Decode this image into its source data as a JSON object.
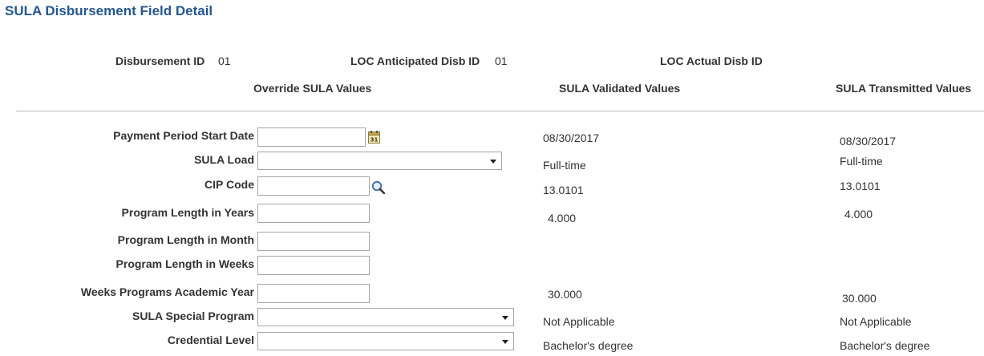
{
  "page": {
    "title": "SULA Disbursement Field Detail"
  },
  "header": {
    "disbursement_id_label": "Disbursement ID",
    "disbursement_id_value": "01",
    "loc_anticipated_label": "LOC Anticipated Disb ID",
    "loc_anticipated_value": "01",
    "loc_actual_label": "LOC Actual Disb ID",
    "loc_actual_value": ""
  },
  "columns": {
    "override": "Override SULA Values",
    "validated": "SULA Validated Values",
    "transmitted": "SULA Transmitted Values"
  },
  "icons": {
    "calendar": "calendar-icon",
    "lookup": "magnifier-icon",
    "dropdown": "chevron-down-icon"
  },
  "rows": [
    {
      "label": "Payment Period Start Date",
      "input": "",
      "validated": "08/30/2017",
      "transmitted": "08/30/2017"
    },
    {
      "label": "SULA Load",
      "input": "",
      "validated": "Full-time",
      "transmitted": "Full-time"
    },
    {
      "label": "CIP Code",
      "input": "",
      "validated": "13.0101",
      "transmitted": "13.0101"
    },
    {
      "label": "Program Length in Years",
      "input": "",
      "validated": "4.000",
      "transmitted": "4.000"
    },
    {
      "label": "Program Length in Month",
      "input": "",
      "validated": "",
      "transmitted": ""
    },
    {
      "label": "Program Length in Weeks",
      "input": "",
      "validated": "",
      "transmitted": ""
    },
    {
      "label": "Weeks Programs Academic Year",
      "input": "",
      "validated": "30.000",
      "transmitted": "30.000"
    },
    {
      "label": "SULA Special Program",
      "input": "",
      "validated": "Not Applicable",
      "transmitted": "Not Applicable"
    },
    {
      "label": "Credential Level",
      "input": "",
      "validated": "Bachelor's degree",
      "transmitted": "Bachelor's degree"
    }
  ]
}
